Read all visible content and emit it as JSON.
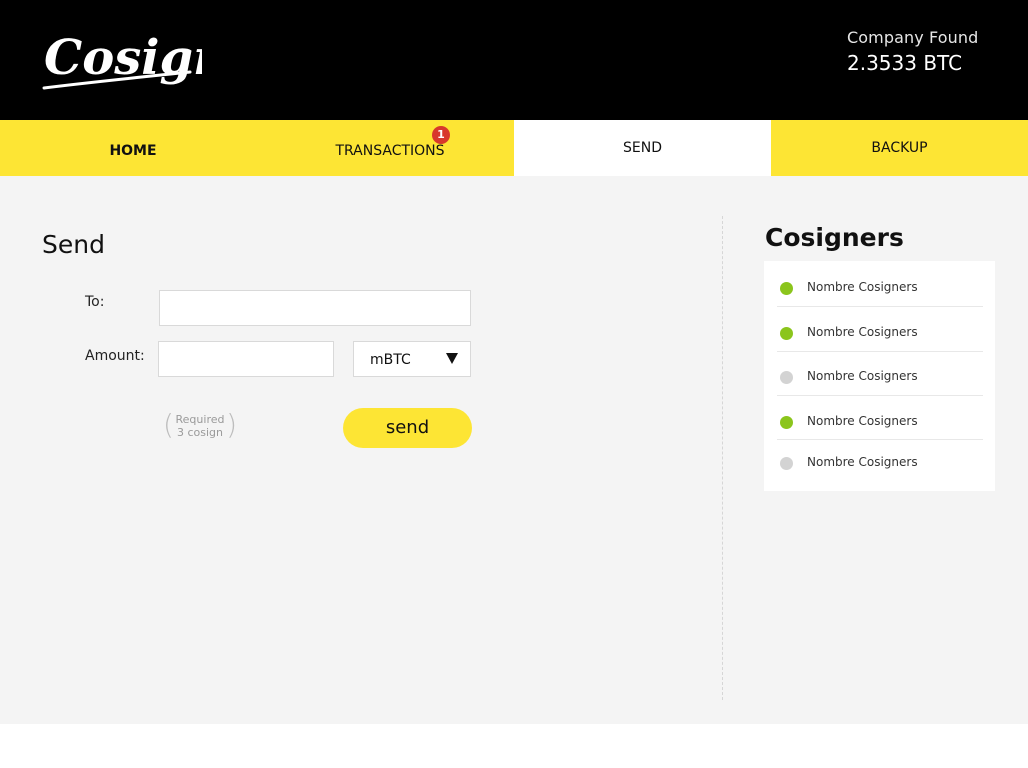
{
  "brand": {
    "logo_text": "Cosign"
  },
  "company": {
    "name": "Company Found",
    "balance": "2.3533 BTC"
  },
  "nav": {
    "tabs": [
      {
        "label": "HOME",
        "active": false
      },
      {
        "label": "TRANSACTIONS",
        "active": false,
        "badge": "1"
      },
      {
        "label": "SEND",
        "active": true
      },
      {
        "label": "BACKUP",
        "active": false
      }
    ]
  },
  "send": {
    "title": "Send",
    "to_label": "To:",
    "to_value": "",
    "amount_label": "Amount:",
    "amount_value": "",
    "unit": "mBTC",
    "required_line1": "Required",
    "required_line2": "3 cosign",
    "button_label": "send"
  },
  "cosigners": {
    "title": "Cosigners",
    "items": [
      {
        "name": "Nombre Cosigners",
        "status": "online"
      },
      {
        "name": "Nombre Cosigners",
        "status": "online"
      },
      {
        "name": "Nombre Cosigners",
        "status": "offline"
      },
      {
        "name": "Nombre Cosigners",
        "status": "online"
      },
      {
        "name": "Nombre Cosigners",
        "status": "offline"
      }
    ]
  },
  "colors": {
    "accent": "#fde534",
    "header_bg": "#000000",
    "badge": "#d8382c",
    "online": "#8bc51c",
    "offline": "#d3d3d3"
  }
}
